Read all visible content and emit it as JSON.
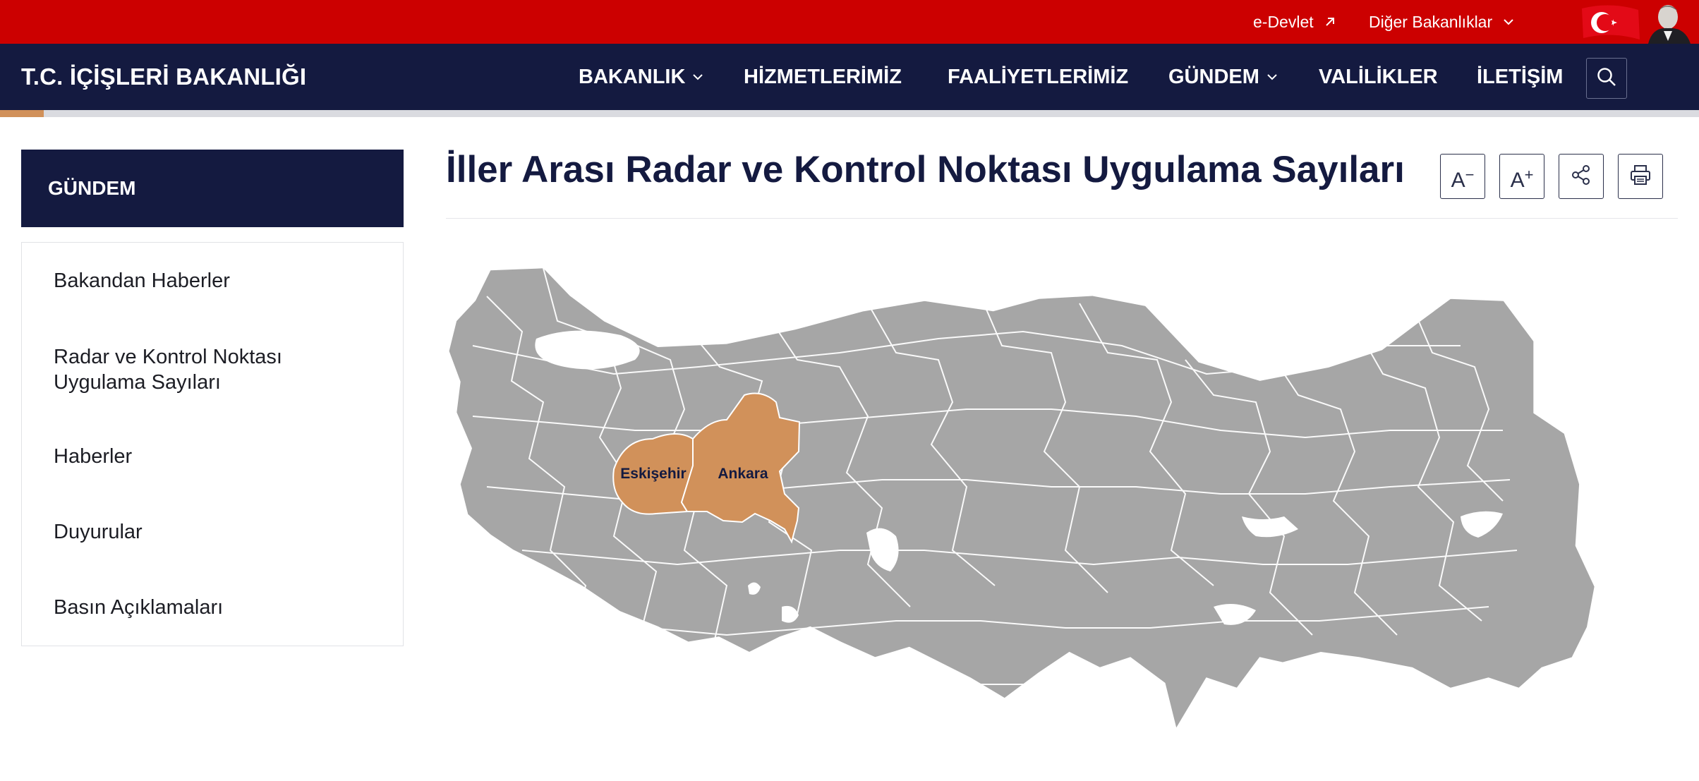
{
  "topbar": {
    "edevlet_label": "e-Devlet",
    "diger_label": "Diğer Bakanlıklar"
  },
  "header": {
    "brand": "T.C. İÇİŞLERİ BAKANLIĞI",
    "nav": [
      {
        "label": "BAKANLIK",
        "has_dropdown": true
      },
      {
        "label": "HİZMETLERİMİZ",
        "has_dropdown": false
      },
      {
        "label": "FAALİYETLERİMİZ",
        "has_dropdown": false
      },
      {
        "label": "GÜNDEM",
        "has_dropdown": true
      },
      {
        "label": "VALİLİKLER",
        "has_dropdown": false
      },
      {
        "label": "İLETİŞİM",
        "has_dropdown": false
      }
    ]
  },
  "sidebar": {
    "title": "GÜNDEM",
    "items": [
      {
        "label": "Bakandan Haberler"
      },
      {
        "label": "Radar ve Kontrol Noktası Uygulama Sayıları"
      },
      {
        "label": "Haberler"
      },
      {
        "label": "Duyurular"
      },
      {
        "label": "Basın Açıklamaları"
      }
    ]
  },
  "main": {
    "title": "İller Arası Radar ve Kontrol Noktası Uygulama Sayıları",
    "tools": {
      "decrease_font": "A",
      "decrease_mark": "−",
      "increase_font": "A",
      "increase_mark": "+"
    },
    "map": {
      "highlighted_provinces": [
        "Eskişehir",
        "Ankara"
      ],
      "colors": {
        "default": "#a6a6a6",
        "highlight": "#d1915a",
        "borders": "#ffffff",
        "label": "#141a40"
      }
    }
  },
  "colors": {
    "red_bar": "#cc0000",
    "navy": "#141a40",
    "accent": "#d1915a"
  }
}
